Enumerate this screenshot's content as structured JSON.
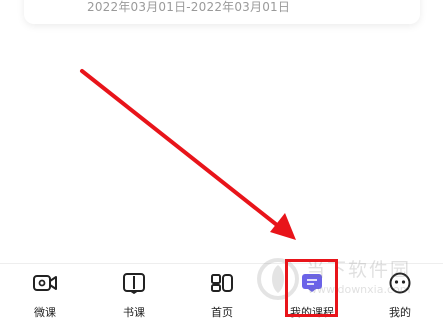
{
  "card": {
    "date_range": "2022年03月01日-2022年03月01日"
  },
  "tabbar": {
    "tabs": [
      {
        "label": "微课",
        "icon": "video-camera-icon"
      },
      {
        "label": "书课",
        "icon": "open-book-icon"
      },
      {
        "label": "首页",
        "icon": "home-grid-icon"
      },
      {
        "label": "我的课程",
        "icon": "course-list-icon"
      },
      {
        "label": "我的",
        "icon": "profile-face-icon"
      }
    ],
    "active_index": 3
  },
  "annotation": {
    "arrow_color": "#e8141a",
    "box_color": "#e8141a"
  },
  "watermark": {
    "title": "当下软件园",
    "url": "www.downxia.com"
  },
  "colors": {
    "active_icon": "#6b63e8",
    "text": "#222222",
    "muted": "#9a9a9a"
  }
}
